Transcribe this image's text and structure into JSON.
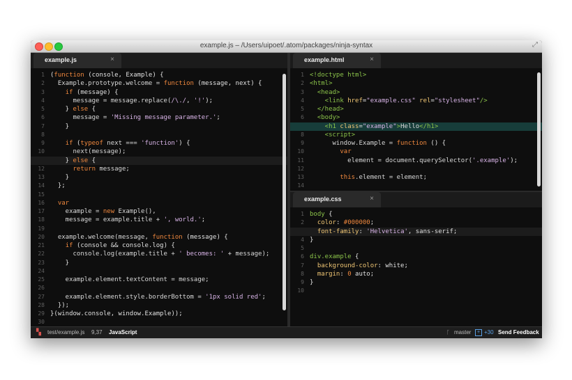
{
  "window": {
    "title": "example.js – /Users/uipoet/.atom/packages/ninja-syntax"
  },
  "colors": {
    "keyword": "#f0883e",
    "punct": "#e0e0e0",
    "ident": "#d8d8d8",
    "func": "#f0c674",
    "string": "#d7b3e6",
    "tag": "#8bc34a",
    "attr": "#f0c674",
    "cyan": "#40c0c0",
    "comment": "#5e5e5e"
  },
  "panes": {
    "js": {
      "tab_label": "example.js",
      "tab_close": "×",
      "current_line": 11,
      "lines": [
        [
          [
            "(",
            "p"
          ],
          [
            "function",
            "k"
          ],
          [
            " (console, Example) {",
            "p"
          ]
        ],
        [
          [
            "  Example.prototype.welcome = ",
            "i"
          ],
          [
            "function",
            "k"
          ],
          [
            " (message, next) {",
            "p"
          ]
        ],
        [
          [
            "    ",
            "i"
          ],
          [
            "if",
            "k"
          ],
          [
            " (message) {",
            "p"
          ]
        ],
        [
          [
            "      message = message.replace(",
            "i"
          ],
          [
            "/\\./",
            "s"
          ],
          [
            ", ",
            "p"
          ],
          [
            "'!'",
            "s"
          ],
          [
            ");",
            "p"
          ]
        ],
        [
          [
            "    } ",
            "p"
          ],
          [
            "else",
            "k"
          ],
          [
            " {",
            "p"
          ]
        ],
        [
          [
            "      message = ",
            "i"
          ],
          [
            "'Missing message parameter.'",
            "s"
          ],
          [
            ";",
            "p"
          ]
        ],
        [
          [
            "    }",
            "p"
          ]
        ],
        [
          [
            "",
            "p"
          ]
        ],
        [
          [
            "    ",
            "i"
          ],
          [
            "if",
            "k"
          ],
          [
            " (",
            "p"
          ],
          [
            "typeof",
            "k"
          ],
          [
            " next === ",
            "i"
          ],
          [
            "'function'",
            "s"
          ],
          [
            ") {",
            "p"
          ]
        ],
        [
          [
            "      next(message);",
            "i"
          ]
        ],
        [
          [
            "    } ",
            "p"
          ],
          [
            "else",
            "k"
          ],
          [
            " {",
            "p"
          ]
        ],
        [
          [
            "      ",
            "i"
          ],
          [
            "return",
            "k"
          ],
          [
            " message;",
            "i"
          ]
        ],
        [
          [
            "    }",
            "p"
          ]
        ],
        [
          [
            "  };",
            "p"
          ]
        ],
        [
          [
            "",
            "p"
          ]
        ],
        [
          [
            "  ",
            "i"
          ],
          [
            "var",
            "k"
          ]
        ],
        [
          [
            "    example = ",
            "i"
          ],
          [
            "new",
            "k"
          ],
          [
            " Example(),",
            "i"
          ]
        ],
        [
          [
            "    message = example.title + ",
            "i"
          ],
          [
            "', world.'",
            "s"
          ],
          [
            ";",
            "p"
          ]
        ],
        [
          [
            "",
            "p"
          ]
        ],
        [
          [
            "  example.welcome(message, ",
            "i"
          ],
          [
            "function",
            "k"
          ],
          [
            " (message) {",
            "p"
          ]
        ],
        [
          [
            "    ",
            "i"
          ],
          [
            "if",
            "k"
          ],
          [
            " (console && console.log) {",
            "p"
          ]
        ],
        [
          [
            "      console.log(example.title + ",
            "i"
          ],
          [
            "' becomes: '",
            "s"
          ],
          [
            " + message);",
            "i"
          ]
        ],
        [
          [
            "    }",
            "p"
          ]
        ],
        [
          [
            "",
            "p"
          ]
        ],
        [
          [
            "    example.element.textContent = message;",
            "i"
          ]
        ],
        [
          [
            "",
            "p"
          ]
        ],
        [
          [
            "    example.element.style.borderBottom = ",
            "i"
          ],
          [
            "'1px solid red'",
            "s"
          ],
          [
            ";",
            "p"
          ]
        ],
        [
          [
            "  });",
            "p"
          ]
        ],
        [
          [
            "}(window.console, window.Example));",
            "p"
          ]
        ],
        [
          [
            "",
            "p"
          ]
        ]
      ]
    },
    "html": {
      "tab_label": "example.html",
      "tab_close": "×",
      "current_line": 7,
      "lines": [
        [
          [
            "<!doctype html>",
            "t"
          ]
        ],
        [
          [
            "<html>",
            "t"
          ]
        ],
        [
          [
            "  <head>",
            "t"
          ]
        ],
        [
          [
            "    <link ",
            "t"
          ],
          [
            "href",
            "a"
          ],
          [
            "=",
            "p"
          ],
          [
            "\"example.css\"",
            "s"
          ],
          [
            " rel",
            "a"
          ],
          [
            "=",
            "p"
          ],
          [
            "\"stylesheet\"",
            "s"
          ],
          [
            "/>",
            "t"
          ]
        ],
        [
          [
            "  </head>",
            "t"
          ]
        ],
        [
          [
            "  <body>",
            "t"
          ]
        ],
        [
          [
            "    <h1 ",
            "t"
          ],
          [
            "class",
            "a"
          ],
          [
            "=",
            "p"
          ],
          [
            "\"example\"",
            "s"
          ],
          [
            ">",
            "t"
          ],
          [
            "Hello",
            "i"
          ],
          [
            "</h1>",
            "t"
          ]
        ],
        [
          [
            "    <script>",
            "t"
          ]
        ],
        [
          [
            "      window.Example = ",
            "i"
          ],
          [
            "function",
            "k"
          ],
          [
            " () {",
            "p"
          ]
        ],
        [
          [
            "        ",
            "i"
          ],
          [
            "var",
            "k"
          ]
        ],
        [
          [
            "          element = document.querySelector(",
            "i"
          ],
          [
            "'.example'",
            "s"
          ],
          [
            ");",
            "p"
          ]
        ],
        [
          [
            "",
            "p"
          ]
        ],
        [
          [
            "        ",
            "i"
          ],
          [
            "this",
            "k"
          ],
          [
            ".element = element;",
            "i"
          ]
        ],
        [
          [
            "",
            "p"
          ]
        ]
      ]
    },
    "css": {
      "tab_label": "example.css",
      "tab_close": "×",
      "current_line": 3,
      "lines": [
        [
          [
            "body",
            "t"
          ],
          [
            " {",
            "p"
          ]
        ],
        [
          [
            "  ",
            "i"
          ],
          [
            "color",
            "a"
          ],
          [
            ": ",
            "p"
          ],
          [
            "#000000",
            "k"
          ],
          [
            ";",
            "p"
          ]
        ],
        [
          [
            "  ",
            "i"
          ],
          [
            "font-family",
            "a"
          ],
          [
            ": ",
            "p"
          ],
          [
            "'Helvetica'",
            "s"
          ],
          [
            ", sans-serif;",
            "p"
          ]
        ],
        [
          [
            "}",
            "p"
          ]
        ],
        [
          [
            "",
            "p"
          ]
        ],
        [
          [
            "div.example",
            "t"
          ],
          [
            " {",
            "p"
          ]
        ],
        [
          [
            "  ",
            "i"
          ],
          [
            "background-color",
            "a"
          ],
          [
            ": white;",
            "p"
          ]
        ],
        [
          [
            "  ",
            "i"
          ],
          [
            "margin",
            "a"
          ],
          [
            ": ",
            "p"
          ],
          [
            "0",
            "k"
          ],
          [
            " auto;",
            "p"
          ]
        ],
        [
          [
            "}",
            "p"
          ]
        ],
        [
          [
            "",
            "p"
          ]
        ]
      ]
    }
  },
  "status": {
    "file": "test/example.js",
    "cursor": "9,37",
    "grammar": "JavaScript",
    "branch": "master",
    "diff": "+30",
    "feedback": "Send Feedback"
  }
}
